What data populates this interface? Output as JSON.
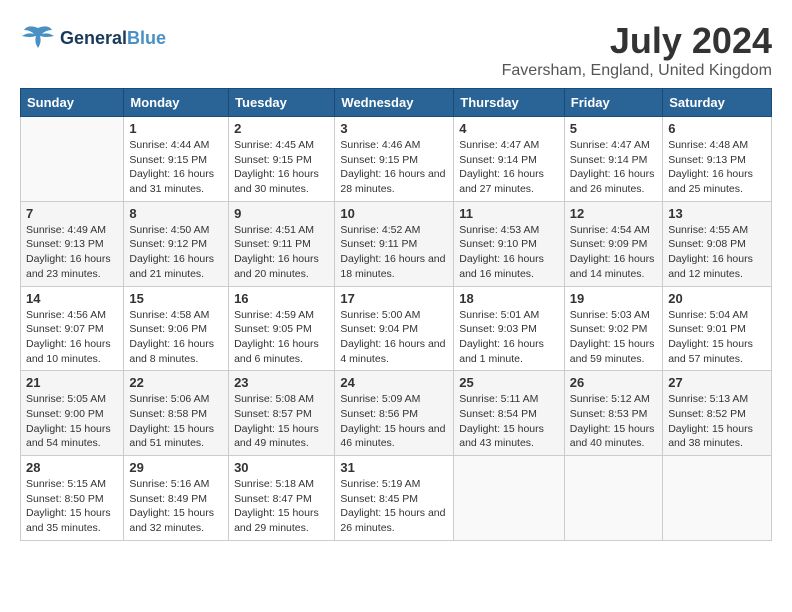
{
  "header": {
    "logo_general": "General",
    "logo_blue": "Blue",
    "month_year": "July 2024",
    "location": "Faversham, England, United Kingdom"
  },
  "weekdays": [
    "Sunday",
    "Monday",
    "Tuesday",
    "Wednesday",
    "Thursday",
    "Friday",
    "Saturday"
  ],
  "weeks": [
    [
      {
        "day": "",
        "sunrise": "",
        "sunset": "",
        "daylight": ""
      },
      {
        "day": "1",
        "sunrise": "Sunrise: 4:44 AM",
        "sunset": "Sunset: 9:15 PM",
        "daylight": "Daylight: 16 hours and 31 minutes."
      },
      {
        "day": "2",
        "sunrise": "Sunrise: 4:45 AM",
        "sunset": "Sunset: 9:15 PM",
        "daylight": "Daylight: 16 hours and 30 minutes."
      },
      {
        "day": "3",
        "sunrise": "Sunrise: 4:46 AM",
        "sunset": "Sunset: 9:15 PM",
        "daylight": "Daylight: 16 hours and 28 minutes."
      },
      {
        "day": "4",
        "sunrise": "Sunrise: 4:47 AM",
        "sunset": "Sunset: 9:14 PM",
        "daylight": "Daylight: 16 hours and 27 minutes."
      },
      {
        "day": "5",
        "sunrise": "Sunrise: 4:47 AM",
        "sunset": "Sunset: 9:14 PM",
        "daylight": "Daylight: 16 hours and 26 minutes."
      },
      {
        "day": "6",
        "sunrise": "Sunrise: 4:48 AM",
        "sunset": "Sunset: 9:13 PM",
        "daylight": "Daylight: 16 hours and 25 minutes."
      }
    ],
    [
      {
        "day": "7",
        "sunrise": "Sunrise: 4:49 AM",
        "sunset": "Sunset: 9:13 PM",
        "daylight": "Daylight: 16 hours and 23 minutes."
      },
      {
        "day": "8",
        "sunrise": "Sunrise: 4:50 AM",
        "sunset": "Sunset: 9:12 PM",
        "daylight": "Daylight: 16 hours and 21 minutes."
      },
      {
        "day": "9",
        "sunrise": "Sunrise: 4:51 AM",
        "sunset": "Sunset: 9:11 PM",
        "daylight": "Daylight: 16 hours and 20 minutes."
      },
      {
        "day": "10",
        "sunrise": "Sunrise: 4:52 AM",
        "sunset": "Sunset: 9:11 PM",
        "daylight": "Daylight: 16 hours and 18 minutes."
      },
      {
        "day": "11",
        "sunrise": "Sunrise: 4:53 AM",
        "sunset": "Sunset: 9:10 PM",
        "daylight": "Daylight: 16 hours and 16 minutes."
      },
      {
        "day": "12",
        "sunrise": "Sunrise: 4:54 AM",
        "sunset": "Sunset: 9:09 PM",
        "daylight": "Daylight: 16 hours and 14 minutes."
      },
      {
        "day": "13",
        "sunrise": "Sunrise: 4:55 AM",
        "sunset": "Sunset: 9:08 PM",
        "daylight": "Daylight: 16 hours and 12 minutes."
      }
    ],
    [
      {
        "day": "14",
        "sunrise": "Sunrise: 4:56 AM",
        "sunset": "Sunset: 9:07 PM",
        "daylight": "Daylight: 16 hours and 10 minutes."
      },
      {
        "day": "15",
        "sunrise": "Sunrise: 4:58 AM",
        "sunset": "Sunset: 9:06 PM",
        "daylight": "Daylight: 16 hours and 8 minutes."
      },
      {
        "day": "16",
        "sunrise": "Sunrise: 4:59 AM",
        "sunset": "Sunset: 9:05 PM",
        "daylight": "Daylight: 16 hours and 6 minutes."
      },
      {
        "day": "17",
        "sunrise": "Sunrise: 5:00 AM",
        "sunset": "Sunset: 9:04 PM",
        "daylight": "Daylight: 16 hours and 4 minutes."
      },
      {
        "day": "18",
        "sunrise": "Sunrise: 5:01 AM",
        "sunset": "Sunset: 9:03 PM",
        "daylight": "Daylight: 16 hours and 1 minute."
      },
      {
        "day": "19",
        "sunrise": "Sunrise: 5:03 AM",
        "sunset": "Sunset: 9:02 PM",
        "daylight": "Daylight: 15 hours and 59 minutes."
      },
      {
        "day": "20",
        "sunrise": "Sunrise: 5:04 AM",
        "sunset": "Sunset: 9:01 PM",
        "daylight": "Daylight: 15 hours and 57 minutes."
      }
    ],
    [
      {
        "day": "21",
        "sunrise": "Sunrise: 5:05 AM",
        "sunset": "Sunset: 9:00 PM",
        "daylight": "Daylight: 15 hours and 54 minutes."
      },
      {
        "day": "22",
        "sunrise": "Sunrise: 5:06 AM",
        "sunset": "Sunset: 8:58 PM",
        "daylight": "Daylight: 15 hours and 51 minutes."
      },
      {
        "day": "23",
        "sunrise": "Sunrise: 5:08 AM",
        "sunset": "Sunset: 8:57 PM",
        "daylight": "Daylight: 15 hours and 49 minutes."
      },
      {
        "day": "24",
        "sunrise": "Sunrise: 5:09 AM",
        "sunset": "Sunset: 8:56 PM",
        "daylight": "Daylight: 15 hours and 46 minutes."
      },
      {
        "day": "25",
        "sunrise": "Sunrise: 5:11 AM",
        "sunset": "Sunset: 8:54 PM",
        "daylight": "Daylight: 15 hours and 43 minutes."
      },
      {
        "day": "26",
        "sunrise": "Sunrise: 5:12 AM",
        "sunset": "Sunset: 8:53 PM",
        "daylight": "Daylight: 15 hours and 40 minutes."
      },
      {
        "day": "27",
        "sunrise": "Sunrise: 5:13 AM",
        "sunset": "Sunset: 8:52 PM",
        "daylight": "Daylight: 15 hours and 38 minutes."
      }
    ],
    [
      {
        "day": "28",
        "sunrise": "Sunrise: 5:15 AM",
        "sunset": "Sunset: 8:50 PM",
        "daylight": "Daylight: 15 hours and 35 minutes."
      },
      {
        "day": "29",
        "sunrise": "Sunrise: 5:16 AM",
        "sunset": "Sunset: 8:49 PM",
        "daylight": "Daylight: 15 hours and 32 minutes."
      },
      {
        "day": "30",
        "sunrise": "Sunrise: 5:18 AM",
        "sunset": "Sunset: 8:47 PM",
        "daylight": "Daylight: 15 hours and 29 minutes."
      },
      {
        "day": "31",
        "sunrise": "Sunrise: 5:19 AM",
        "sunset": "Sunset: 8:45 PM",
        "daylight": "Daylight: 15 hours and 26 minutes."
      },
      {
        "day": "",
        "sunrise": "",
        "sunset": "",
        "daylight": ""
      },
      {
        "day": "",
        "sunrise": "",
        "sunset": "",
        "daylight": ""
      },
      {
        "day": "",
        "sunrise": "",
        "sunset": "",
        "daylight": ""
      }
    ]
  ]
}
